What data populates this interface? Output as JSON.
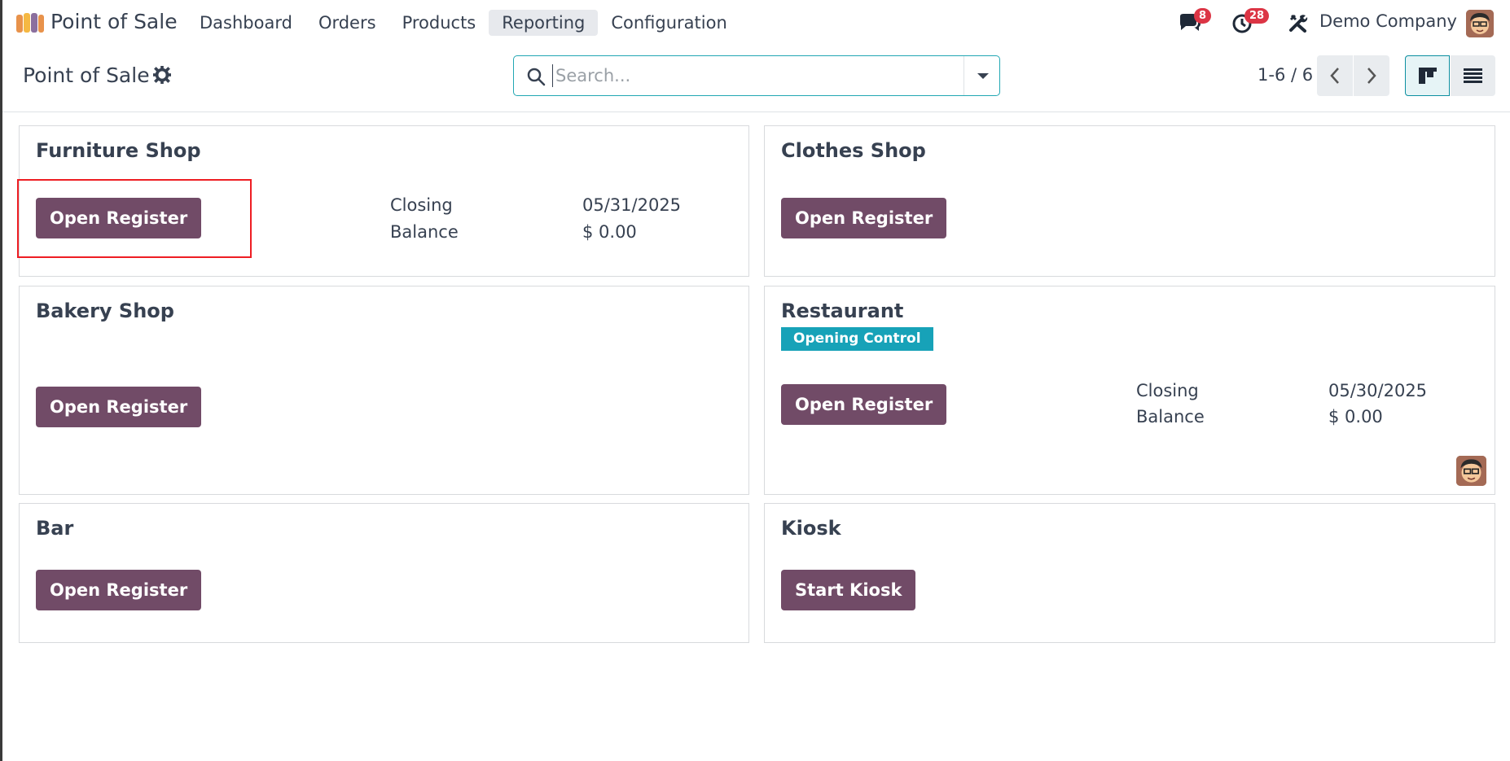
{
  "navbar": {
    "app_name": "Point of Sale",
    "menu": [
      "Dashboard",
      "Orders",
      "Products",
      "Reporting",
      "Configuration"
    ],
    "active_menu": "Reporting",
    "messages_count": "8",
    "activities_count": "28",
    "company": "Demo Company"
  },
  "control_panel": {
    "title": "Point of Sale",
    "search_placeholder": "Search...",
    "pager": "1-6 / 6"
  },
  "cards": [
    {
      "title": "Furniture Shop",
      "button": "Open Register",
      "closing_label": "Closing",
      "closing_date": "05/31/2025",
      "balance_label": "Balance",
      "balance": "$ 0.00"
    },
    {
      "title": "Clothes Shop",
      "button": "Open Register"
    },
    {
      "title": "Bakery Shop",
      "button": "Open Register"
    },
    {
      "title": "Restaurant",
      "badge": "Opening Control",
      "button": "Open Register",
      "closing_label": "Closing",
      "closing_date": "05/30/2025",
      "balance_label": "Balance",
      "balance": "$ 0.00"
    },
    {
      "title": "Bar",
      "button": "Open Register"
    },
    {
      "title": "Kiosk",
      "button": "Start Kiosk"
    }
  ],
  "colors": {
    "primary": "#714b67",
    "accent": "#17a2b8",
    "highlight": "#ee1d23"
  }
}
